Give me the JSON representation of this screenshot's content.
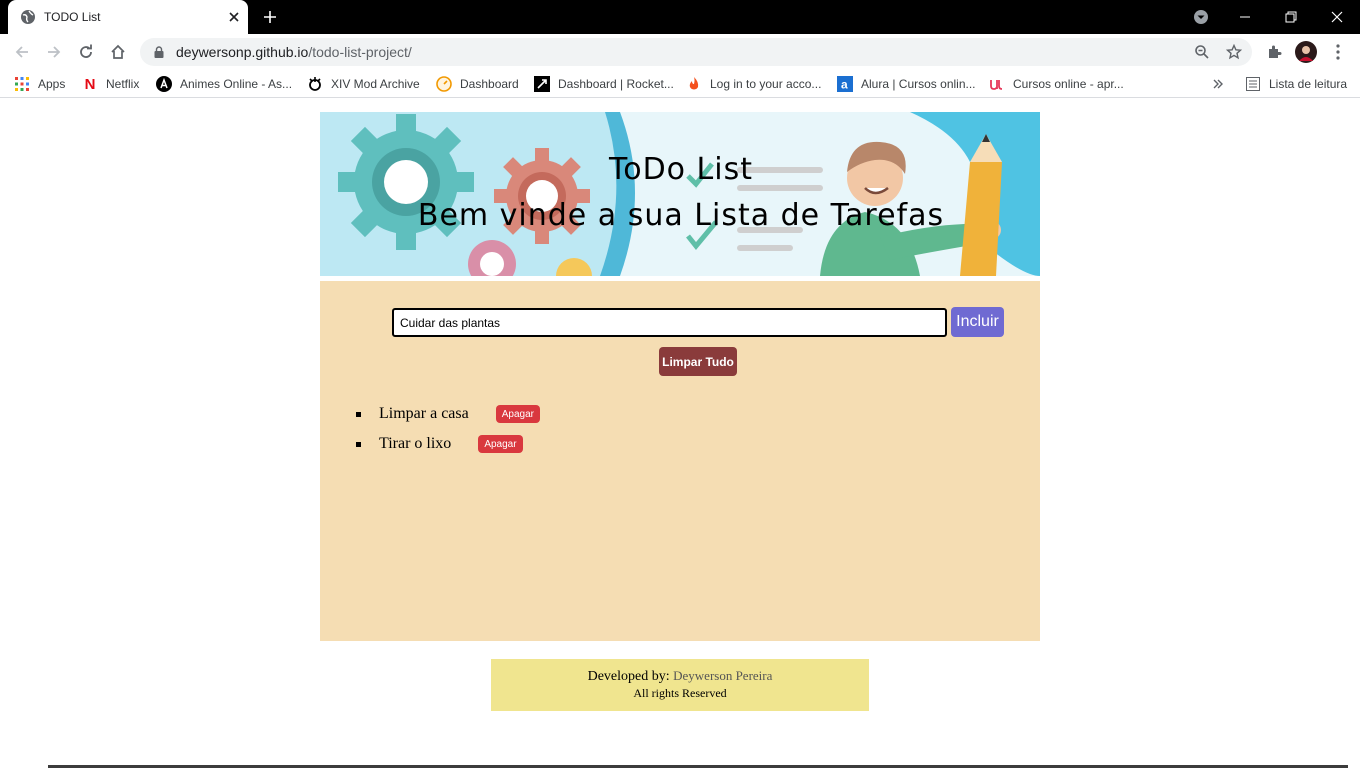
{
  "browser": {
    "tab_title": "TODO List",
    "url_host": "deywersonp.github.io",
    "url_path": "/todo-list-project/",
    "bookmarks": [
      {
        "label": "Apps",
        "icon": "apps-grid-icon"
      },
      {
        "label": "Netflix",
        "icon": "netflix-icon"
      },
      {
        "label": "Animes Online - As...",
        "icon": "anime-icon"
      },
      {
        "label": "XIV Mod Archive",
        "icon": "mod-archive-icon"
      },
      {
        "label": "Dashboard",
        "icon": "dashboard-icon"
      },
      {
        "label": "Dashboard | Rocket...",
        "icon": "rocket-icon"
      },
      {
        "label": "Log in to your acco...",
        "icon": "flame-icon"
      },
      {
        "label": "Alura | Cursos onlin...",
        "icon": "alura-icon"
      },
      {
        "label": "Cursos online - apr...",
        "icon": "udemy-icon"
      }
    ],
    "reading_list_label": "Lista de leitura"
  },
  "banner": {
    "title": "ToDo List",
    "subtitle": "Bem vinde a sua Lista de Tarefas"
  },
  "form": {
    "input_value": "Cuidar das plantas",
    "add_label": "Incluir",
    "clear_label": "Limpar Tudo"
  },
  "tasks": [
    {
      "text": "Limpar a casa",
      "delete_label": "Apagar"
    },
    {
      "text": "Tirar o lixo",
      "delete_label": "Apagar"
    }
  ],
  "footer": {
    "developed_by": "Developed by:",
    "author": "Deywerson Pereira",
    "rights": "All rights Reserved"
  },
  "colors": {
    "panel_bg": "#f5ddb3",
    "add_button": "#6f6ad2",
    "clear_button": "#8a3b3b",
    "delete_button": "#d9383e",
    "footer_bg": "#f0e58f"
  }
}
